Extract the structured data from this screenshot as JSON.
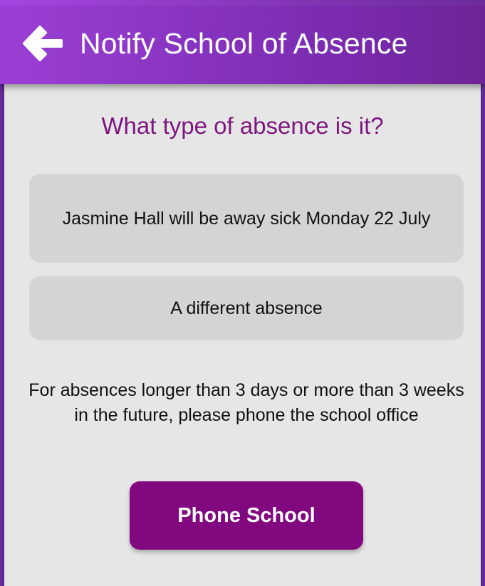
{
  "header": {
    "title": "Notify School of Absence",
    "back_icon": "arrow-left-icon"
  },
  "main": {
    "question": "What type of absence is it?",
    "options": [
      {
        "label": "Jasmine Hall will be away sick Monday 22 July"
      },
      {
        "label": "A different absence"
      }
    ],
    "info_text": "For absences longer than 3 days or more than 3 weeks in the future, please phone the school office",
    "phone_button_label": "Phone School"
  },
  "colors": {
    "header_gradient_start": "#9b3fd4",
    "header_gradient_end": "#6e2496",
    "accent_text": "#7e167f",
    "button_bg": "#82087f",
    "option_bg": "#d4d4d4",
    "page_bg": "#e6e6e6"
  }
}
